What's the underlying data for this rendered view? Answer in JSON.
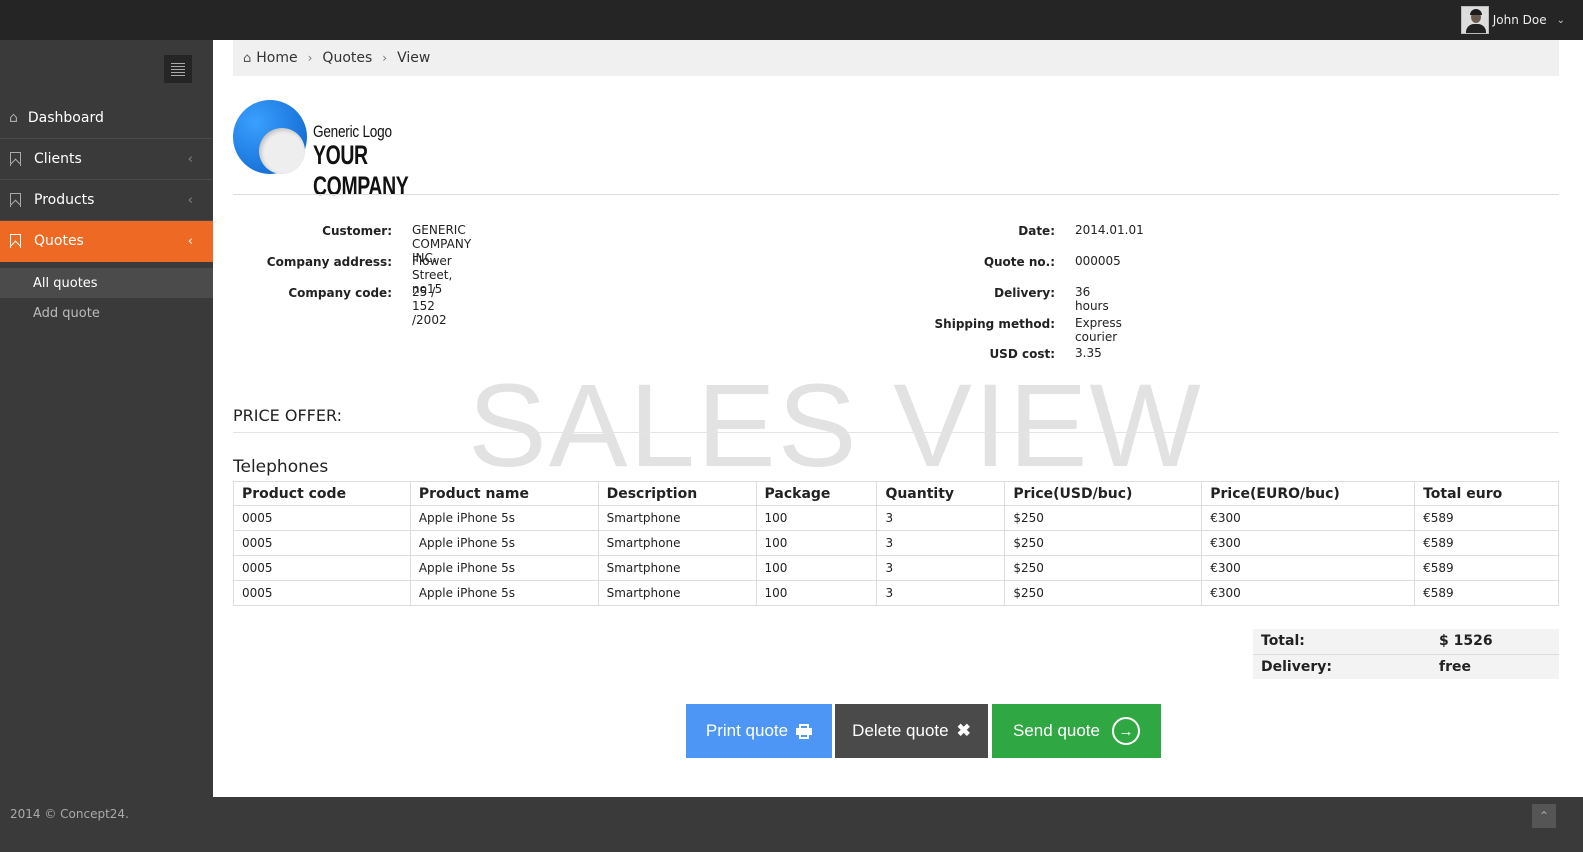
{
  "topbar": {
    "user_name": "John Doe",
    "dropdown_icon": "chevron-down-icon"
  },
  "sidebar": {
    "items": [
      {
        "label": "Dashboard",
        "icon": "home-icon"
      },
      {
        "label": "Clients",
        "icon": "bookmark-icon"
      },
      {
        "label": "Products",
        "icon": "bookmark-icon"
      },
      {
        "label": "Quotes",
        "icon": "bookmark-icon",
        "active": true
      }
    ],
    "subitems": [
      {
        "label": "All quotes",
        "selected": true
      },
      {
        "label": "Add quote"
      }
    ],
    "active_color": "#ee6a24"
  },
  "breadcrumb": {
    "home": "Home",
    "quotes": "Quotes",
    "view": "View"
  },
  "logo": {
    "line1": "Generic Logo",
    "line2": "YOUR COMPANY"
  },
  "customer_info": {
    "customer_label": "Customer:",
    "customer_value": "GENERIC COMPANY INC.",
    "address_label": "Company address:",
    "address_value": "Flower Street, no15",
    "code_label": "Company code:",
    "code_value": "25 / 152 /2002"
  },
  "quote_info": {
    "date_label": "Date:",
    "date_value": "2014.01.01",
    "quote_no_label": "Quote no.:",
    "quote_no_value": "000005",
    "delivery_label": "Delivery:",
    "delivery_value": "36 hours",
    "shipping_label": "Shipping method:",
    "shipping_value": "Express courier",
    "usd_label": "USD cost:",
    "usd_value": "3.35"
  },
  "price_offer_title": "PRICE OFFER:",
  "watermark": "SALES VIEW",
  "section_title": "Telephones",
  "table": {
    "headers": [
      "Product code",
      "Product name",
      "Description",
      "Package",
      "Quantity",
      "Price(USD/buc)",
      "Price(EURO/buc)",
      "Total euro"
    ],
    "rows": [
      [
        "0005",
        "Apple iPhone 5s",
        "Smartphone",
        "100",
        "3",
        "$250",
        "€300",
        "€589"
      ],
      [
        "0005",
        "Apple iPhone 5s",
        "Smartphone",
        "100",
        "3",
        "$250",
        "€300",
        "€589"
      ],
      [
        "0005",
        "Apple iPhone 5s",
        "Smartphone",
        "100",
        "3",
        "$250",
        "€300",
        "€589"
      ],
      [
        "0005",
        "Apple iPhone 5s",
        "Smartphone",
        "100",
        "3",
        "$250",
        "€300",
        "€589"
      ]
    ]
  },
  "totals": {
    "total_label": "Total:",
    "total_value": "$ 1526",
    "delivery_label": "Delivery:",
    "delivery_value": "free"
  },
  "actions": {
    "print_label": "Print quote",
    "delete_label": "Delete quote",
    "send_label": "Send quote",
    "print_color": "#4d96f5",
    "delete_color": "#4a4a4a",
    "send_color": "#2fa843"
  },
  "footer": {
    "copyright": "2014 © Concept24."
  }
}
